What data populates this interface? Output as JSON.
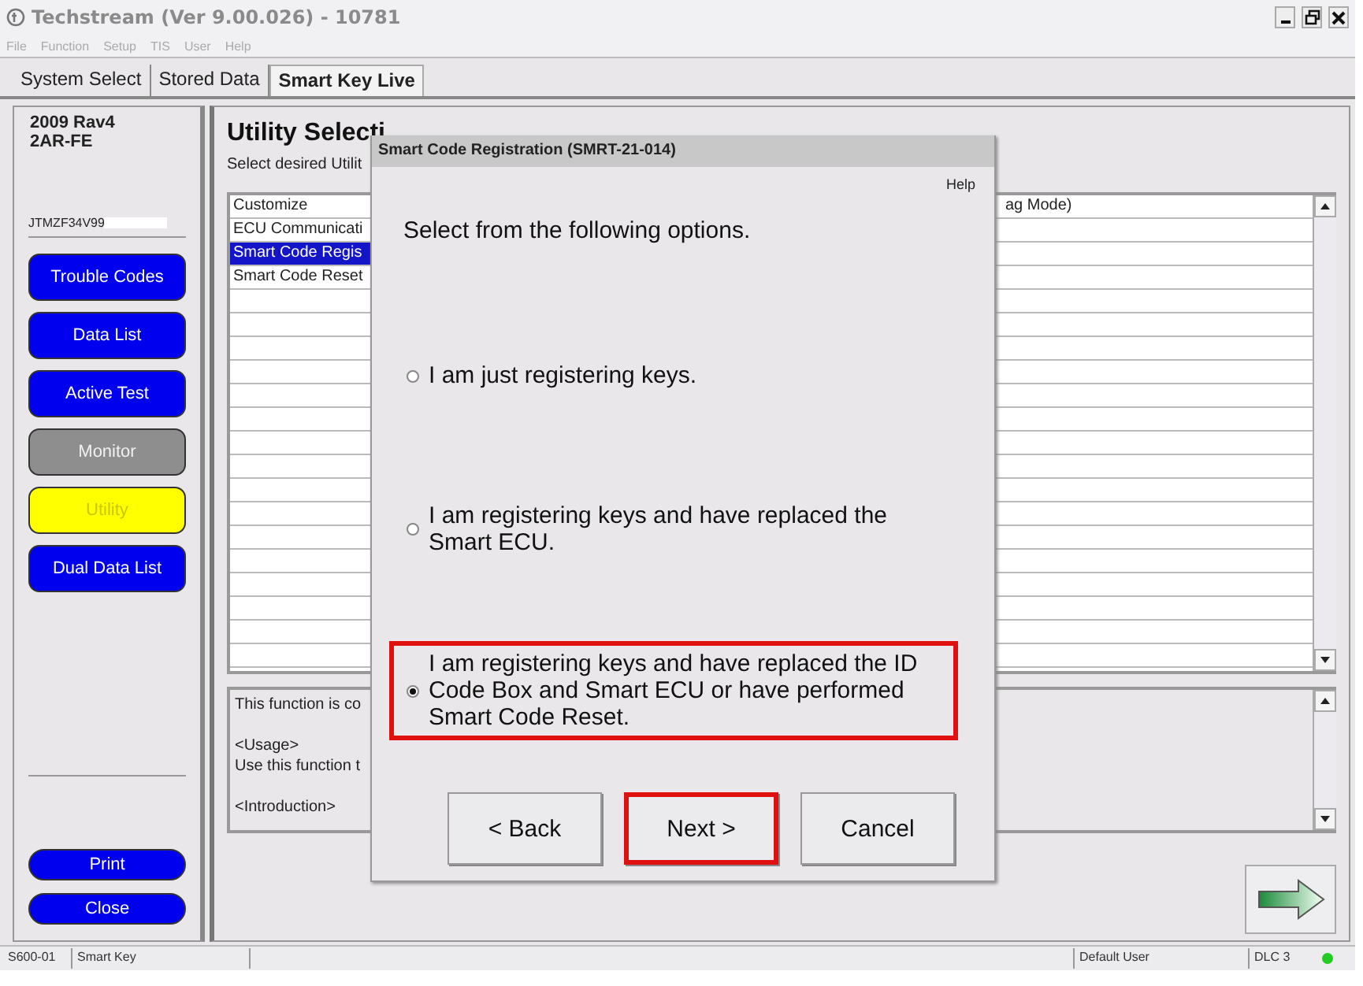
{
  "window": {
    "title": "Techstream (Ver 9.00.026) - 10781"
  },
  "menu": [
    "File",
    "Function",
    "Setup",
    "TIS",
    "User",
    "Help"
  ],
  "tabs": [
    {
      "label": "System Select",
      "selected": false
    },
    {
      "label": "Stored Data",
      "selected": false
    },
    {
      "label": "Smart Key Live",
      "selected": true
    }
  ],
  "vehicle": {
    "model": "2009 Rav4",
    "engine": "2AR-FE",
    "vin": "JTMZF34V99"
  },
  "sidebar": {
    "buttons": [
      {
        "label": "Trouble Codes",
        "selected": false,
        "disabled": false
      },
      {
        "label": "Data List",
        "selected": false,
        "disabled": false
      },
      {
        "label": "Active Test",
        "selected": false,
        "disabled": false
      },
      {
        "label": "Monitor",
        "selected": false,
        "disabled": true
      },
      {
        "label": "Utility",
        "selected": true,
        "disabled": false
      },
      {
        "label": "Dual Data List",
        "selected": false,
        "disabled": false
      }
    ],
    "bottom_buttons": [
      "Print",
      "Close"
    ]
  },
  "main": {
    "heading": "Utility Selecti",
    "instruction": "Select desired Utilit",
    "list": [
      {
        "text": "Customize",
        "column_3": "ag Mode)",
        "selected": false
      },
      {
        "text": "ECU Communicati",
        "selected": false
      },
      {
        "text": "Smart Code Regis",
        "selected": true
      },
      {
        "text": "Smart Code Reset",
        "selected": false
      }
    ],
    "description": [
      "This function is co",
      "<Usage>",
      "Use this function t",
      "<Introduction>"
    ]
  },
  "dialog": {
    "title": "Smart Code Registration (SMRT-21-014)",
    "help": "Help",
    "prompt": "Select from the following options.",
    "options": [
      {
        "label": "I am just registering keys.",
        "selected": false,
        "highlighted": false
      },
      {
        "label": "I am registering keys and have replaced the Smart ECU.",
        "selected": false,
        "highlighted": false
      },
      {
        "label": "I am registering keys and have replaced the ID Code Box and Smart ECU or have performed Smart Code Reset.",
        "selected": true,
        "highlighted": true
      }
    ],
    "buttons": [
      {
        "label": "< Back",
        "highlighted": false
      },
      {
        "label": "Next >",
        "highlighted": true
      },
      {
        "label": "Cancel",
        "highlighted": false
      }
    ]
  },
  "status_bar": {
    "fields": [
      "S600-01",
      "Smart Key",
      "Default User",
      "DLC 3"
    ],
    "connected": true
  }
}
